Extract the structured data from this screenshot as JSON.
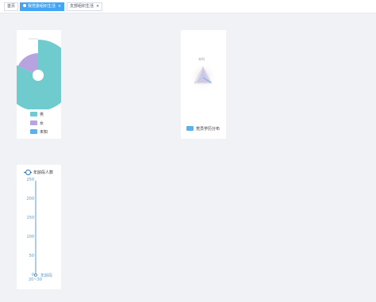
{
  "tabs": [
    {
      "label": "首页"
    },
    {
      "label": "我党委组织生活"
    },
    {
      "label": "支部组织生活"
    }
  ],
  "gender_chart": {
    "legend": [
      "男",
      "女",
      "未知"
    ]
  },
  "edu_chart": {
    "indicator_top": "本科",
    "indicator_left": "",
    "indicator_right": "",
    "legend": "党员学历分布"
  },
  "age_chart": {
    "legend": "年龄段人数",
    "y_ticks": [
      "250",
      "200",
      "150",
      "100",
      "50",
      "0"
    ],
    "x_category": "20~30",
    "axis_name": "年龄段"
  },
  "chart_data": [
    {
      "type": "pie",
      "categories": [
        "男",
        "女",
        "未知"
      ],
      "values": [
        82,
        18,
        0
      ],
      "colors": [
        "#70cbcf",
        "#b7a3df",
        "#5ab1ef"
      ]
    },
    {
      "type": "radar",
      "indicators": [
        "本科",
        "",
        ""
      ],
      "series": [
        {
          "name": "党员学历分布",
          "color": "#5ab1ef"
        }
      ]
    },
    {
      "type": "line",
      "categories": [
        "20~30"
      ],
      "series": [
        {
          "name": "年龄段人数",
          "values": [
            0
          ],
          "color": "#2f6fb5"
        }
      ],
      "ylim": [
        0,
        250
      ],
      "y_ticks": [
        0,
        50,
        100,
        150,
        200,
        250
      ]
    }
  ],
  "colors": {
    "accent": "#42a5f5",
    "male": "#70cbcf",
    "female": "#b7a3df",
    "unknown": "#5ab1ef"
  }
}
